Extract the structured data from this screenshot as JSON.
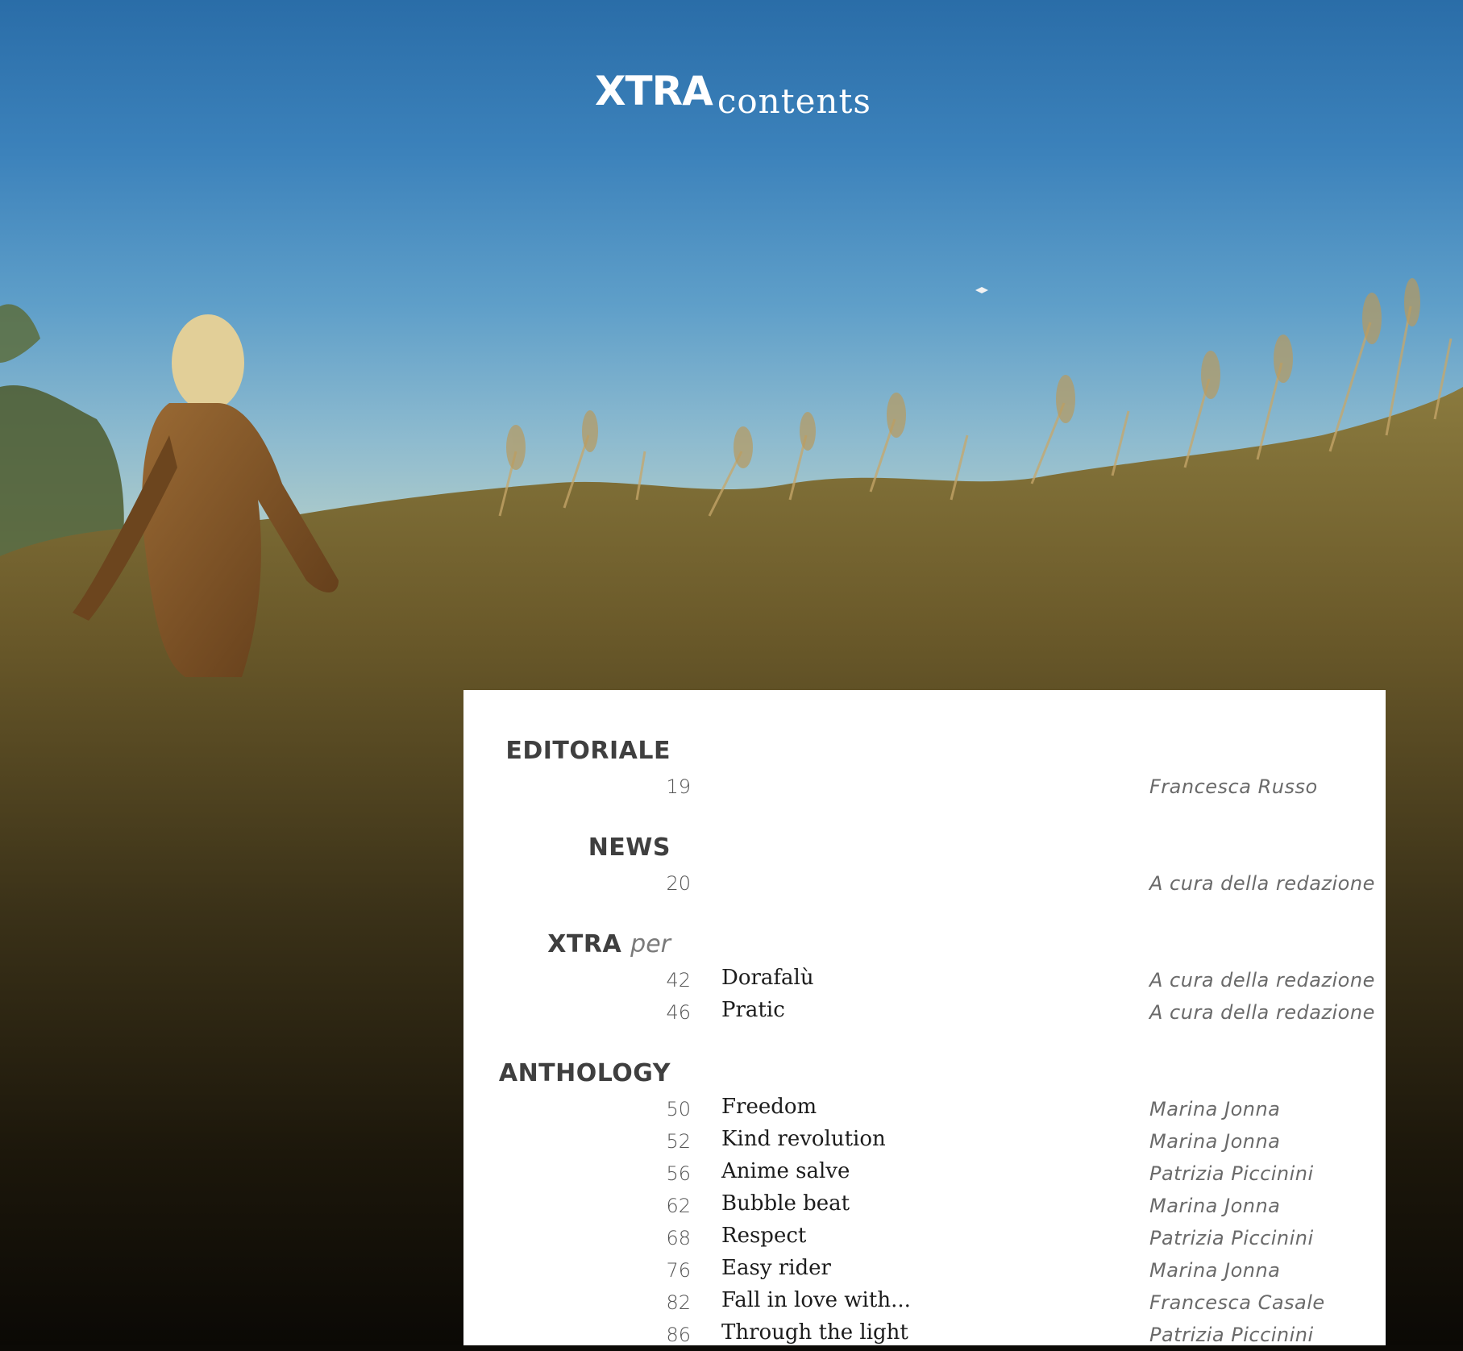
{
  "masthead": {
    "brand": "XTRA",
    "label": "contents"
  },
  "sections": [
    {
      "heading": "EDITORIALE",
      "heading_sub": "",
      "entries": [
        {
          "page": "19",
          "title": "",
          "author": "Francesca Russo"
        }
      ]
    },
    {
      "heading": "NEWS",
      "heading_sub": "",
      "entries": [
        {
          "page": "20",
          "title": "",
          "author": "A cura della redazione"
        }
      ]
    },
    {
      "heading": "XTRA",
      "heading_sub": "per",
      "entries": [
        {
          "page": "42",
          "title": "Dorafalù",
          "author": "A cura della redazione"
        },
        {
          "page": "46",
          "title": "Pratic",
          "author": "A cura della redazione"
        }
      ]
    },
    {
      "heading": "ANTHOLOGY",
      "heading_sub": "",
      "entries": [
        {
          "page": "50",
          "title": "Freedom",
          "author": "Marina Jonna"
        },
        {
          "page": "52",
          "title": "Kind revolution",
          "author": "Marina Jonna"
        },
        {
          "page": "56",
          "title": "Anime salve",
          "author": "Patrizia Piccinini"
        },
        {
          "page": "62",
          "title": "Bubble beat",
          "author": "Marina Jonna"
        },
        {
          "page": "68",
          "title": "Respect",
          "author": "Patrizia Piccinini"
        },
        {
          "page": "76",
          "title": "Easy rider",
          "author": "Marina Jonna"
        },
        {
          "page": "82",
          "title": "Fall in love with...",
          "author": "Francesca Casale"
        },
        {
          "page": "86",
          "title": "Through the light",
          "author": "Patrizia Piccinini"
        }
      ]
    }
  ]
}
